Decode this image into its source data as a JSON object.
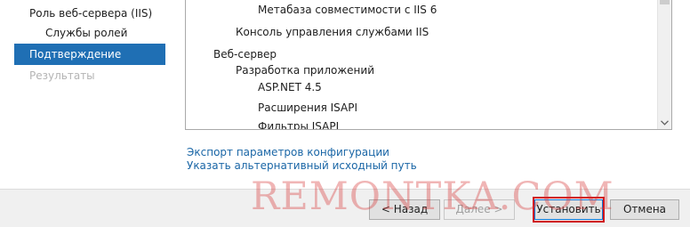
{
  "sidebar": {
    "items": [
      {
        "label": "Роль веб-сервера (IIS)",
        "state": "normal"
      },
      {
        "label": "Службы ролей",
        "state": "normal"
      },
      {
        "label": "Подтверждение",
        "state": "active"
      },
      {
        "label": "Результаты",
        "state": "disabled"
      }
    ]
  },
  "features": {
    "items": [
      {
        "label": "Метабаза совместимости с IIS 6"
      },
      {
        "label": "Консоль управления службами IIS"
      },
      {
        "label": "Веб-сервер"
      },
      {
        "label": "Разработка приложений"
      },
      {
        "label": "ASP.NET 4.5"
      },
      {
        "label": "Расширения ISAPI"
      },
      {
        "label": "Фильтры ISAPI"
      }
    ]
  },
  "links": {
    "export_config": "Экспорт параметров конфигурации",
    "alt_source_path": "Указать альтернативный исходный путь"
  },
  "buttons": {
    "back": "< Назад",
    "next": "Далее >",
    "install": "Установить",
    "cancel": "Отмена"
  },
  "watermark": "REMONTKA.COM",
  "colors": {
    "active_nav": "#1f6fb4",
    "link": "#1a66a6",
    "highlight": "#d0141c"
  }
}
